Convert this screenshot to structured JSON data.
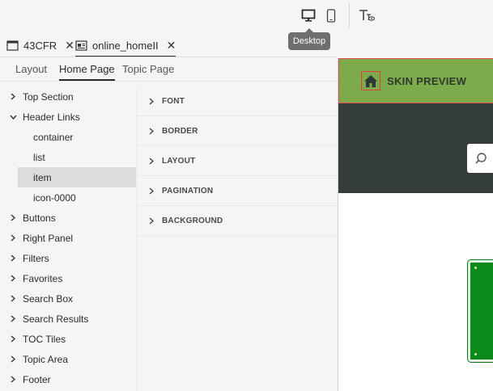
{
  "toolbar": {
    "desktop_icon": "desktop-icon",
    "mobile_icon": "mobile-icon",
    "text_preview_icon": "text-preview-icon",
    "tooltip": "Desktop"
  },
  "file_tabs": [
    {
      "label": "43CFR",
      "icon": "window-icon",
      "close": "✕"
    },
    {
      "label": "online_homeII",
      "icon": "layout-icon",
      "close": "✕"
    }
  ],
  "section_tabs": [
    {
      "label": "Layout"
    },
    {
      "label": "Home Page"
    },
    {
      "label": "Topic Page"
    }
  ],
  "tree": {
    "top_section": "Top Section",
    "header_links": "Header Links",
    "children": [
      "container",
      "list",
      "item",
      "icon-0000"
    ],
    "items": [
      "Buttons",
      "Right Panel",
      "Filters",
      "Favorites",
      "Search Box",
      "Search Results",
      "TOC Tiles",
      "Topic Area",
      "Footer"
    ]
  },
  "properties": [
    "FONT",
    "BORDER",
    "LAYOUT",
    "PAGINATION",
    "BACKGROUND"
  ],
  "preview": {
    "title": "SKIN PREVIEW",
    "home_icon": "home-icon",
    "search_icon": "search-icon",
    "header_color": "#7daa4a",
    "dark_band_color": "#353d3d",
    "card_color": "#0b8a1b"
  }
}
